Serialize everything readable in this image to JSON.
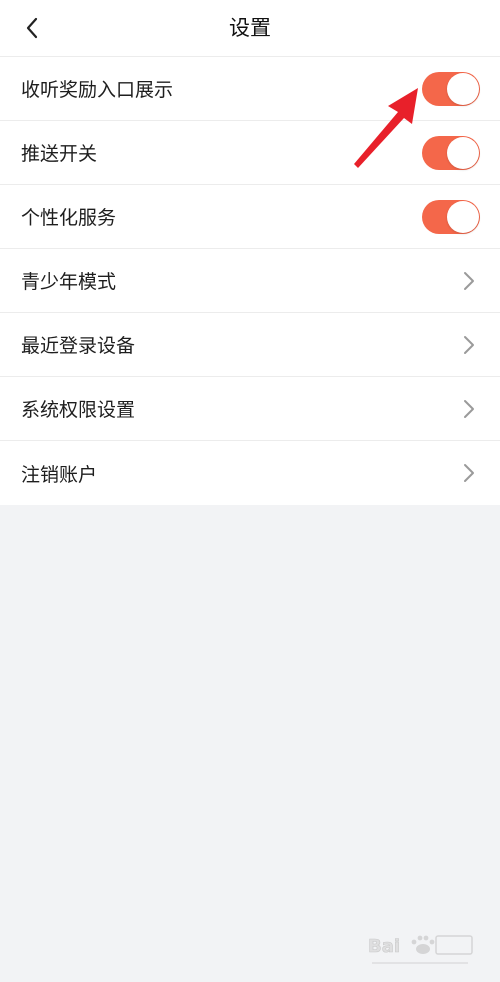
{
  "header": {
    "title": "设置",
    "back_icon": "chevron-left-icon"
  },
  "settings": [
    {
      "label": "收听奖励入口展示",
      "control": "toggle",
      "on": true
    },
    {
      "label": "推送开关",
      "control": "toggle",
      "on": true
    },
    {
      "label": "个性化服务",
      "control": "toggle",
      "on": true
    },
    {
      "label": "青少年模式",
      "control": "chevron"
    },
    {
      "label": "最近登录设备",
      "control": "chevron"
    },
    {
      "label": "系统权限设置",
      "control": "chevron"
    },
    {
      "label": "注销账户",
      "control": "chevron"
    }
  ],
  "colors": {
    "toggle_on": "#f4674a",
    "annotation_arrow": "#e8202a",
    "background": "#f2f3f5"
  }
}
